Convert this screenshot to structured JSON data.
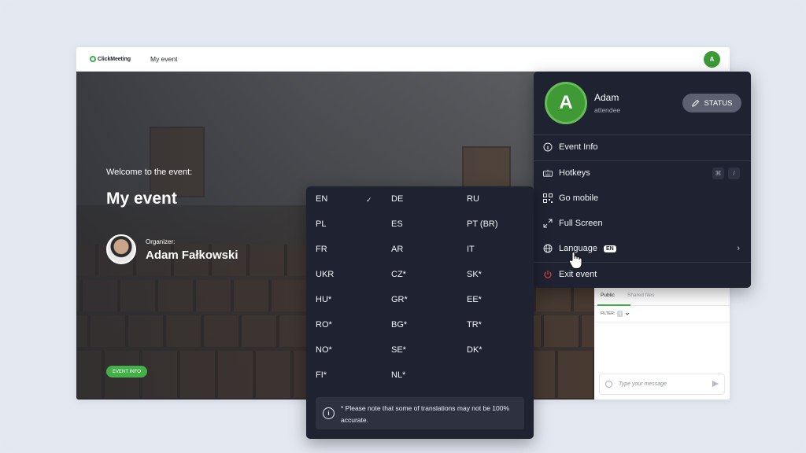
{
  "brand": {
    "logo_text": "ClickMeeting",
    "accent": "#43b04a",
    "dark_panel": "#1f2230"
  },
  "topbar": {
    "event_title": "My event",
    "avatar_letter": "A"
  },
  "hero": {
    "welcome": "Welcome to the event:",
    "title": "My event",
    "organizer_label": "Organizer:",
    "organizer_name": "Adam Fałkowski",
    "event_info_button": "EVENT INFO"
  },
  "chat": {
    "tabs": [
      "Public",
      "Shared files"
    ],
    "filter_label": "FILTER:",
    "filter_count": "0",
    "message_placeholder": "Type your message"
  },
  "user_menu": {
    "avatar_letter": "A",
    "name": "Adam",
    "role": "attendee",
    "status_button": "STATUS",
    "items": [
      {
        "label": "Event Info",
        "icon": "info-icon"
      },
      {
        "label": "Hotkeys",
        "icon": "keyboard-icon",
        "shortcut": [
          "⌘",
          "/"
        ]
      },
      {
        "label": "Go mobile",
        "icon": "qr-code-icon"
      },
      {
        "label": "Full Screen",
        "icon": "fullscreen-icon"
      },
      {
        "label": "Language",
        "icon": "globe-icon",
        "badge": "EN"
      },
      {
        "label": "Exit event",
        "icon": "power-icon",
        "color": "#e0453a"
      }
    ]
  },
  "language_panel": {
    "selected": "EN",
    "languages": [
      [
        "EN",
        "DE",
        "RU"
      ],
      [
        "PL",
        "ES",
        "PT (BR)"
      ],
      [
        "FR",
        "AR",
        "IT"
      ],
      [
        "UKR",
        "CZ*",
        "SK*"
      ],
      [
        "HU*",
        "GR*",
        "EE*"
      ],
      [
        "RO*",
        "BG*",
        "TR*"
      ],
      [
        "NO*",
        "SE*",
        "DK*"
      ],
      [
        "FI*",
        "NL*",
        ""
      ]
    ],
    "note": "* Please note that some of translations may not be 100% accurate."
  }
}
